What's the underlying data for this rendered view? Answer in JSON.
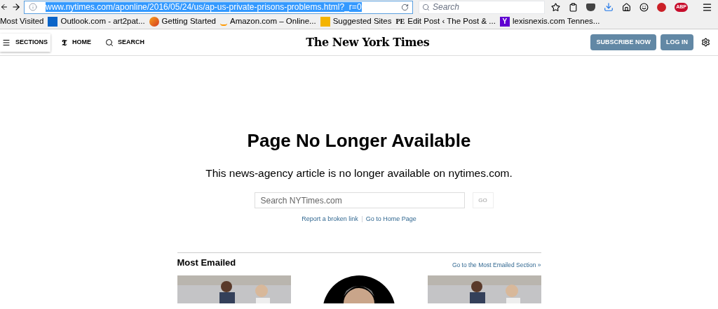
{
  "browser": {
    "url": "www.nytimes.com/aponline/2016/05/24/us/ap-us-private-prisons-problems.html?_r=0",
    "search_placeholder": "Search",
    "bookmarks": [
      {
        "label": "Most Visited",
        "kind": "none"
      },
      {
        "label": "Outlook.com - art2pat...",
        "kind": "outlook"
      },
      {
        "label": "Getting Started",
        "kind": "firefox"
      },
      {
        "label": "Amazon.com – Online...",
        "kind": "amazon"
      },
      {
        "label": "Suggested Sites",
        "kind": "bing"
      },
      {
        "label": "Edit Post ‹ The Post & ...",
        "kind": "pe",
        "icon_text": "PE"
      },
      {
        "label": "lexisnexis.com Tennes...",
        "kind": "yahoo",
        "icon_text": "Y"
      }
    ],
    "abp_text": "ABP"
  },
  "header": {
    "sections": "SECTIONS",
    "home": "HOME",
    "home_glyph": "𝕿",
    "search": "SEARCH",
    "logo": "The New York Times",
    "subscribe": "SUBSCRIBE NOW",
    "login": "LOG IN"
  },
  "main": {
    "title": "Page No Longer Available",
    "message": "This news-agency article is no longer available on nytimes.com.",
    "search_placeholder": "Search NYTimes.com",
    "go": "GO",
    "links": [
      "Report a broken link",
      "Go to Home Page"
    ]
  },
  "most_emailed": {
    "title": "Most Emailed",
    "link": "Go to the Most Emailed Section »",
    "items": [
      {
        "kind": "picture"
      },
      {
        "kind": "round"
      },
      {
        "kind": "picture"
      }
    ]
  }
}
